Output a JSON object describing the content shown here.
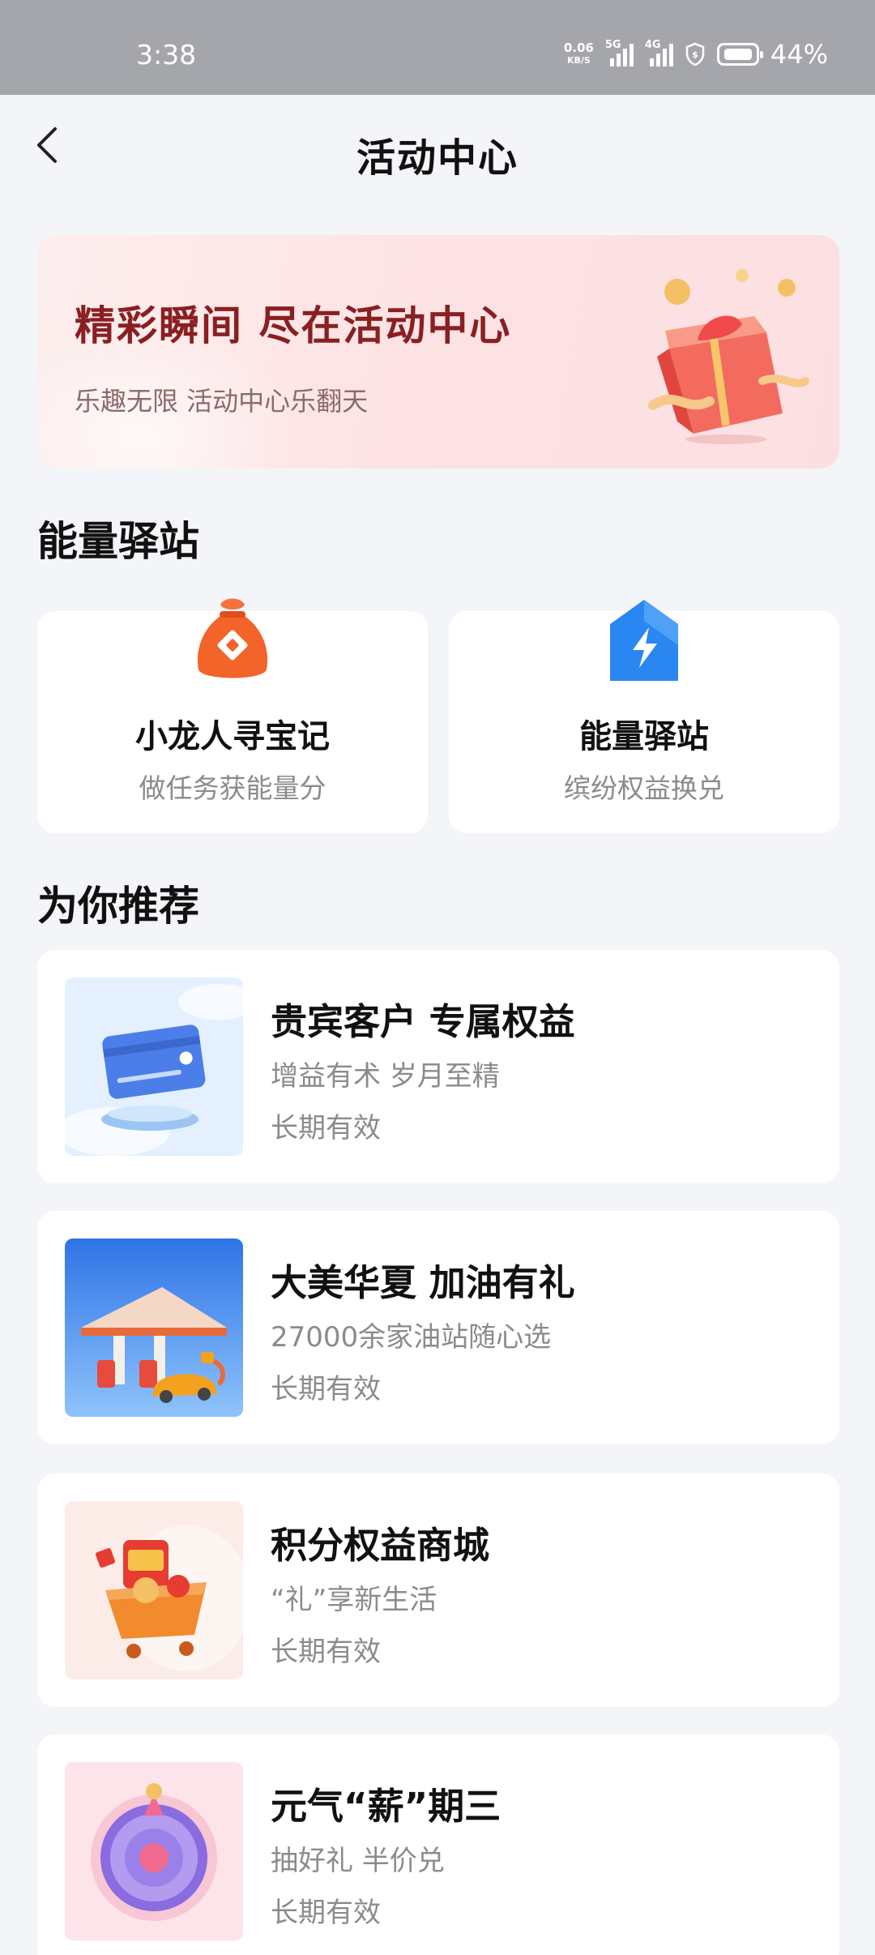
{
  "status_bar": {
    "time": "3:38",
    "net_speed_value": "0.06",
    "net_speed_unit": "KB/S",
    "signal1_label": "5G",
    "signal2_label": "4G",
    "battery_pct": "44%"
  },
  "header": {
    "title": "活动中心",
    "back_icon": "chevron-left-icon"
  },
  "banner": {
    "title": "精彩瞬间 尽在活动中心",
    "subtitle": "乐趣无限 活动中心乐翻天",
    "image": "gift-box-icon"
  },
  "energy_section": {
    "title": "能量驿站",
    "cards": [
      {
        "name": "小龙人寻宝记",
        "desc": "做任务获能量分",
        "icon": "money-bag-icon"
      },
      {
        "name": "能量驿站",
        "desc": "缤纷权益换兑",
        "icon": "energy-house-icon"
      }
    ]
  },
  "recommend_section": {
    "title": "为你推荐",
    "items": [
      {
        "title": "贵宾客户 专属权益",
        "subtitle": "增益有术 岁月至精",
        "validity": "长期有效",
        "image": "credit-card-image"
      },
      {
        "title": "大美华夏 加油有礼",
        "subtitle": "27000余家油站随心选",
        "validity": "长期有效",
        "image": "gas-station-image"
      },
      {
        "title": "积分权益商城",
        "subtitle": "“礼”享新生活",
        "validity": "长期有效",
        "image": "gift-cart-image"
      },
      {
        "title": "元气“薪”期三",
        "subtitle": "抽好礼 半价兑",
        "validity": "长期有效",
        "image": "lucky-wheel-image"
      }
    ]
  },
  "colors": {
    "status_bar_bg": "#a4a6ab",
    "page_bg": "#f3f5f9",
    "banner_title": "#8a1f22",
    "accent_orange": "#f2642a",
    "accent_blue": "#2a86f0"
  }
}
